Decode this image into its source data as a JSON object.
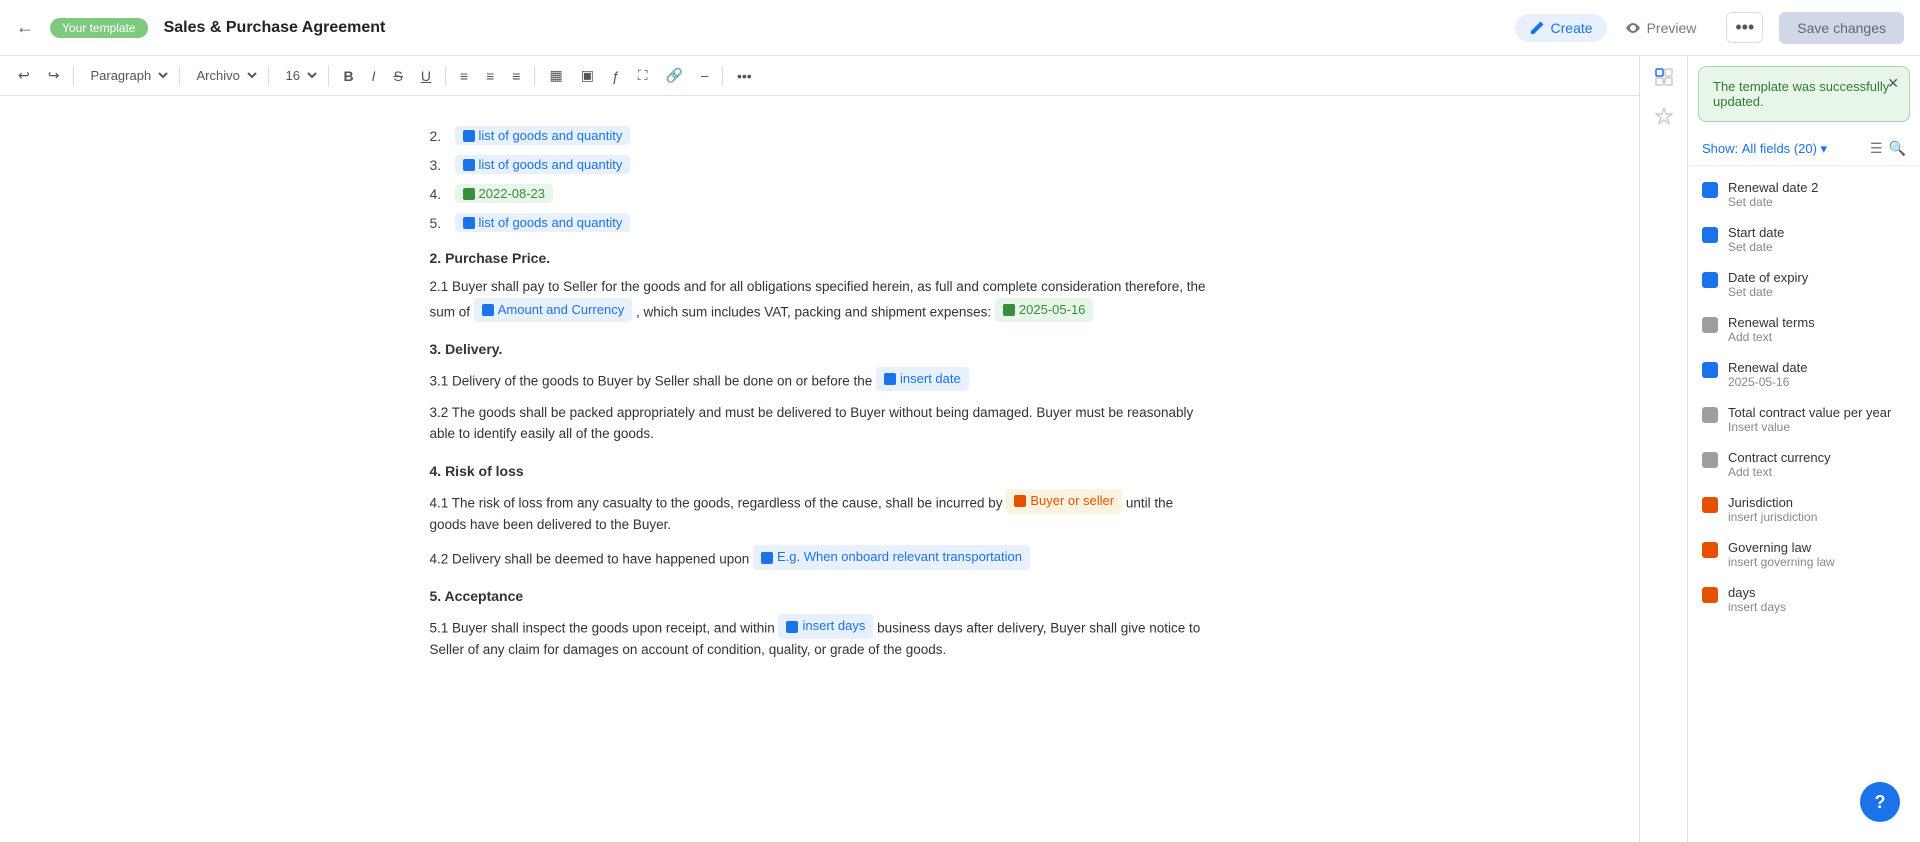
{
  "topbar": {
    "back_icon": "←",
    "template_badge": "Your template",
    "doc_title": "Sales & Purchase Agreement",
    "tabs": [
      {
        "id": "create",
        "label": "Create",
        "active": true,
        "icon": "pencil"
      },
      {
        "id": "preview",
        "label": "Preview",
        "active": false,
        "icon": "eye"
      }
    ],
    "more_icon": "•••",
    "save_label": "Save changes"
  },
  "toolbar": {
    "undo": "↩",
    "redo": "↪",
    "paragraph": "Paragraph",
    "font": "Archivo",
    "size": "16",
    "bold": "B",
    "italic": "I",
    "strikethrough": "S",
    "underline": "U",
    "align": "≡",
    "list_ul": "☰",
    "list_ol": "☷",
    "more": "•••"
  },
  "editor": {
    "list_items": [
      {
        "num": "2.",
        "text": "list of goods and quantity",
        "type": "text-tag"
      },
      {
        "num": "3.",
        "text": "list of goods and quantity",
        "type": "text-tag"
      },
      {
        "num": "4.",
        "text": "2022-08-23",
        "type": "date-tag"
      },
      {
        "num": "5.",
        "text": "list of goods and quantity",
        "type": "text-tag"
      }
    ],
    "sections": [
      {
        "heading": "2. Purchase Price.",
        "paragraphs": [
          {
            "id": "2.1",
            "before": "2.1 Buyer shall pay to Seller for the goods and for all obligations specified herein, as full and complete consideration therefore, the sum of",
            "field1": "Amount and Currency",
            "field1_type": "text-tag",
            "middle": ", which sum includes VAT, packing and shipment expenses:",
            "field2": "2025-05-16",
            "field2_type": "date-tag",
            "after": ""
          }
        ]
      },
      {
        "heading": "3. Delivery.",
        "paragraphs": [
          {
            "id": "3.1",
            "before": "3.1 Delivery of the goods to Buyer by Seller shall be done on or before the",
            "field1": "insert date",
            "field1_type": "text-tag",
            "after": ""
          },
          {
            "id": "3.2",
            "text": "3.2 The goods shall be packed appropriately and must be delivered to Buyer without being damaged. Buyer must be reasonably able to identify easily all of the goods."
          }
        ]
      },
      {
        "heading": "4. Risk of loss",
        "paragraphs": [
          {
            "id": "4.1",
            "before": "4.1 The risk of loss from any casualty to the goods, regardless of the cause, shall be incurred by",
            "field1": "Buyer or seller",
            "field1_type": "multi-tag",
            "after": "until the goods have been delivered to the Buyer."
          },
          {
            "id": "4.2",
            "before": "4.2 Delivery shall be deemed to have happened upon",
            "field1": "E.g. When onboard relevant transportation",
            "field1_type": "text-tag",
            "after": ""
          }
        ]
      },
      {
        "heading": "5. Acceptance",
        "paragraphs": [
          {
            "id": "5.1",
            "before": "5.1 Buyer shall inspect the goods upon receipt, and within",
            "field1": "insert days",
            "field1_type": "text-tag",
            "after": "business days after delivery, Buyer shall give notice to Seller of any claim for damages on account of condition, quality, or grade of the goods."
          }
        ]
      }
    ]
  },
  "right_panel": {
    "toast": {
      "text": "The template was successfully updated."
    },
    "show_label": "Show:",
    "all_fields_label": "All fields",
    "all_fields_count": "(20)",
    "fields": [
      {
        "name": "Renewal date 2",
        "value": "Set date",
        "icon": "fi-blue"
      },
      {
        "name": "Start date",
        "value": "Set date",
        "icon": "fi-blue"
      },
      {
        "name": "Date of expiry",
        "value": "Set date",
        "icon": "fi-blue"
      },
      {
        "name": "Renewal terms",
        "value": "Add text",
        "icon": "fi-gray"
      },
      {
        "name": "Renewal date",
        "value": "2025-05-16",
        "icon": "fi-blue"
      },
      {
        "name": "Total contract value per year",
        "value": "Insert value",
        "icon": "fi-gray"
      },
      {
        "name": "Contract currency",
        "value": "Add text",
        "icon": "fi-gray"
      },
      {
        "name": "Jurisdiction",
        "value": "insert jurisdiction",
        "icon": "fi-orange"
      },
      {
        "name": "Governing law",
        "value": "insert governing law",
        "icon": "fi-orange"
      },
      {
        "name": "days",
        "value": "insert days",
        "icon": "fi-orange"
      }
    ]
  },
  "help_btn_label": "?"
}
